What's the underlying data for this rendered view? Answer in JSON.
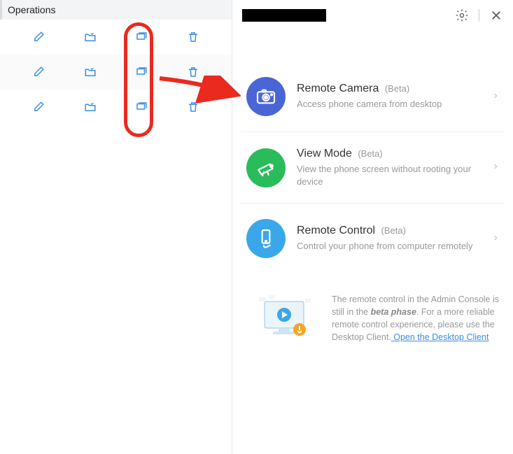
{
  "left": {
    "header": "Operations",
    "rowCount": 3,
    "icons": [
      "edit-icon",
      "folder-icon",
      "window-icon",
      "trash-icon"
    ]
  },
  "right": {
    "deviceName": "",
    "features": [
      {
        "title": "Remote Camera",
        "beta": "(Beta)",
        "desc": "Access phone camera from desktop",
        "iconBg": "#4a66d6",
        "iconName": "camera-icon"
      },
      {
        "title": "View Mode",
        "beta": "(Beta)",
        "desc": "View the phone screen without rooting your device",
        "iconBg": "#2abb5b",
        "iconName": "telescope-icon"
      },
      {
        "title": "Remote Control",
        "beta": "(Beta)",
        "desc": "Control your phone from computer remotely",
        "iconBg": "#3aa7ea",
        "iconName": "phone-hand-icon"
      }
    ],
    "notice": {
      "part1": "The remote control in the Admin Console is still in the ",
      "betaPhase": "beta phase",
      "part2": ". For a more reliable remote control experience, please use the Desktop Client.",
      "linkText": " Open the Desktop Client"
    }
  }
}
